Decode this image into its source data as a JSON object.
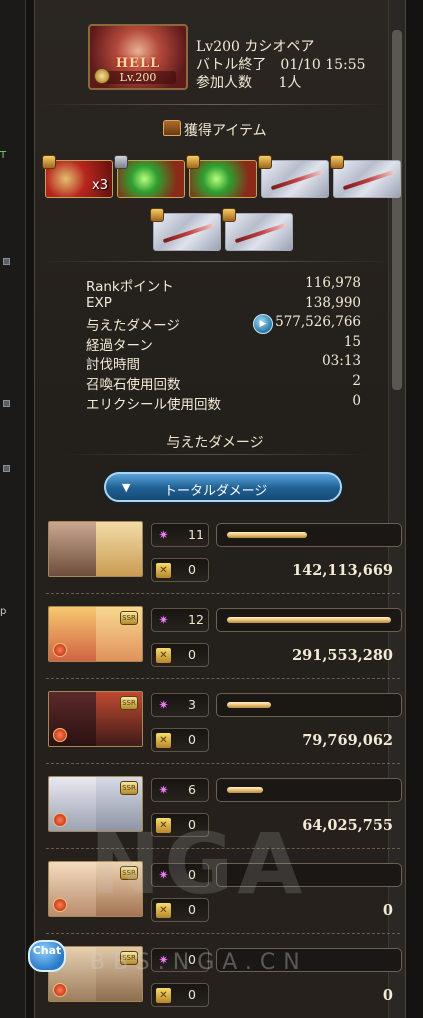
{
  "outer": {
    "left_marks": [
      "T",
      "p"
    ]
  },
  "header": {
    "quest_label": "HELL",
    "quest_level": "Lv.200",
    "quest_name": "Lv200 カシオペア",
    "battle_end": "バトル終了　01/10 15:55",
    "participants_label": "参加人数",
    "participants_value": "1人"
  },
  "items_section": {
    "title": "獲得アイテム",
    "row1": [
      {
        "kind": "red",
        "qty": "x3",
        "badge": "gold"
      },
      {
        "kind": "green",
        "qty": "",
        "badge": "gray"
      },
      {
        "kind": "green",
        "qty": "",
        "badge": "gold"
      },
      {
        "kind": "silver",
        "qty": "",
        "badge": "gold"
      },
      {
        "kind": "silver",
        "qty": "",
        "badge": "gold"
      }
    ],
    "row2": [
      {
        "kind": "silver",
        "qty": "",
        "badge": "gold"
      },
      {
        "kind": "silver",
        "qty": "",
        "badge": "gold"
      }
    ]
  },
  "stats": [
    {
      "label": "Rankポイント",
      "value": "116,978"
    },
    {
      "label": "EXP",
      "value": "138,990"
    },
    {
      "label": "与えたダメージ",
      "value": "577,526,766"
    },
    {
      "label": "経過ターン",
      "value": "15"
    },
    {
      "label": "討伐時間",
      "value": "03:13"
    },
    {
      "label": "召喚石使用回数",
      "value": "2"
    },
    {
      "label": "エリクシール使用回数",
      "value": "0"
    }
  ],
  "damage_section": {
    "title": "与えたダメージ",
    "total_button": "トータルダメージ"
  },
  "party": [
    {
      "hits": "11",
      "buffs": "0",
      "damage": "142,113,669",
      "fraction": 0.49
    },
    {
      "hits": "12",
      "buffs": "0",
      "damage": "291,553,280",
      "fraction": 1.0
    },
    {
      "hits": "3",
      "buffs": "0",
      "damage": "79,769,062",
      "fraction": 0.27
    },
    {
      "hits": "6",
      "buffs": "0",
      "damage": "64,025,755",
      "fraction": 0.22
    },
    {
      "hits": "0",
      "buffs": "0",
      "damage": "0",
      "fraction": 0
    },
    {
      "hits": "0",
      "buffs": "0",
      "damage": "0",
      "fraction": 0
    }
  ],
  "watermark": {
    "logo": "NGA",
    "site": "BBS.NGA.CN"
  },
  "chat": {
    "label": "Chat"
  },
  "colors": {
    "accent_blue": "#2b77a8",
    "gold": "#e8c478",
    "star": "#ee7af4"
  }
}
